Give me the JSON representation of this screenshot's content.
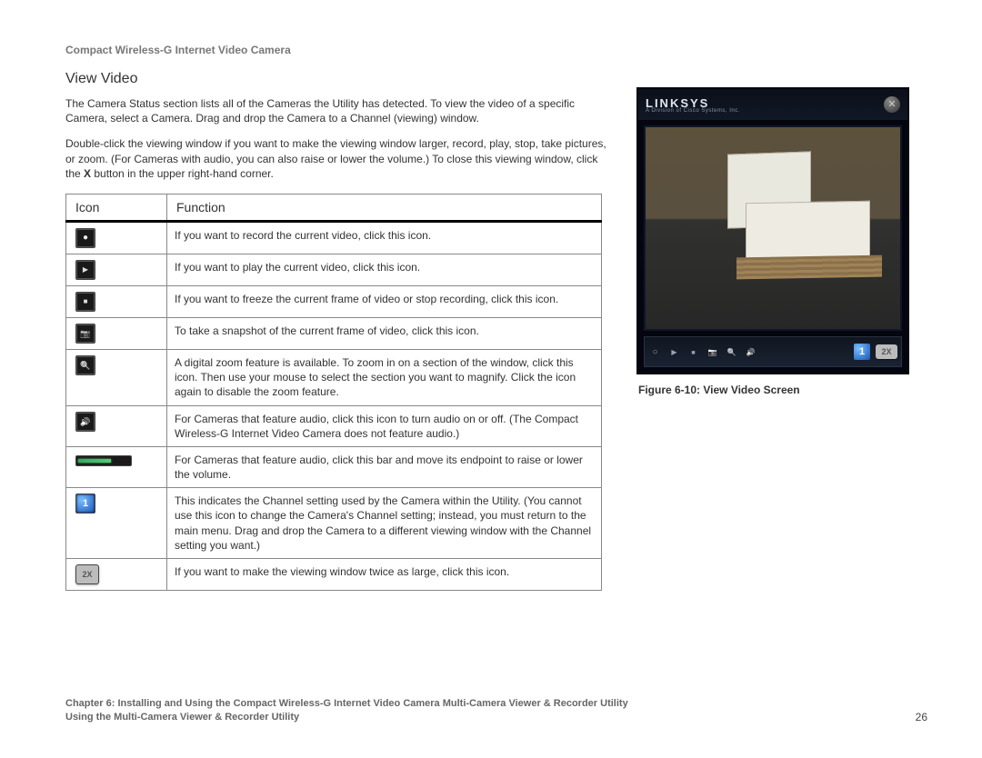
{
  "header": "Compact Wireless-G Internet Video Camera",
  "section_title": "View Video",
  "para1": "The Camera Status section lists all of the Cameras the Utility has detected. To view the video of a specific Camera, select a Camera. Drag and drop the Camera to a Channel (viewing) window.",
  "para2_pre": "Double-click the viewing window if you want to make the viewing window larger, record, play, stop, take pictures, or zoom. (For Cameras with audio, you can also raise or lower the volume.) To close this viewing window, click the ",
  "para2_bold": "X",
  "para2_post": " button in the upper right-hand corner.",
  "table": {
    "headers": [
      "Icon",
      "Function"
    ],
    "rows": [
      {
        "icon": "record",
        "text": "If you want to record the current video, click this icon."
      },
      {
        "icon": "play",
        "text": "If you want to play the current video, click this icon."
      },
      {
        "icon": "stop",
        "text": "If you want to freeze the current frame of video or stop recording, click this icon."
      },
      {
        "icon": "snap",
        "text": "To take a snapshot of the current frame of video, click this icon."
      },
      {
        "icon": "zoom",
        "text": "A digital zoom feature is available. To zoom in on a section of the window, click this icon. Then use your mouse to select the section you want to magnify. Click the icon again to disable the zoom feature."
      },
      {
        "icon": "audio",
        "text": "For Cameras that feature audio, click this icon to turn audio on or off. (The Compact Wireless-G Internet Video Camera does not feature audio.)"
      },
      {
        "icon": "volume",
        "text": "For Cameras that feature audio, click this bar and move its endpoint to raise or lower the volume."
      },
      {
        "icon": "channel",
        "text": "This indicates the Channel setting used by the Camera within the Utility. (You cannot use this icon to change the Camera's Channel setting; instead, you must return to the main menu. Drag and drop the Camera to a different viewing window with the Channel setting you want.)"
      },
      {
        "icon": "twox",
        "text": "If you want to make the viewing window twice as large, click this icon."
      }
    ]
  },
  "figure": {
    "brand": "LINKSYS",
    "brand_sub": "A Division of Cisco Systems, Inc.",
    "caption": "Figure 6-10: View Video Screen"
  },
  "footer": {
    "line1": "Chapter 6: Installing and Using the Compact Wireless-G Internet Video Camera Multi-Camera Viewer & Recorder Utility",
    "line2": "Using the Multi-Camera Viewer & Recorder Utility",
    "page": "26"
  }
}
